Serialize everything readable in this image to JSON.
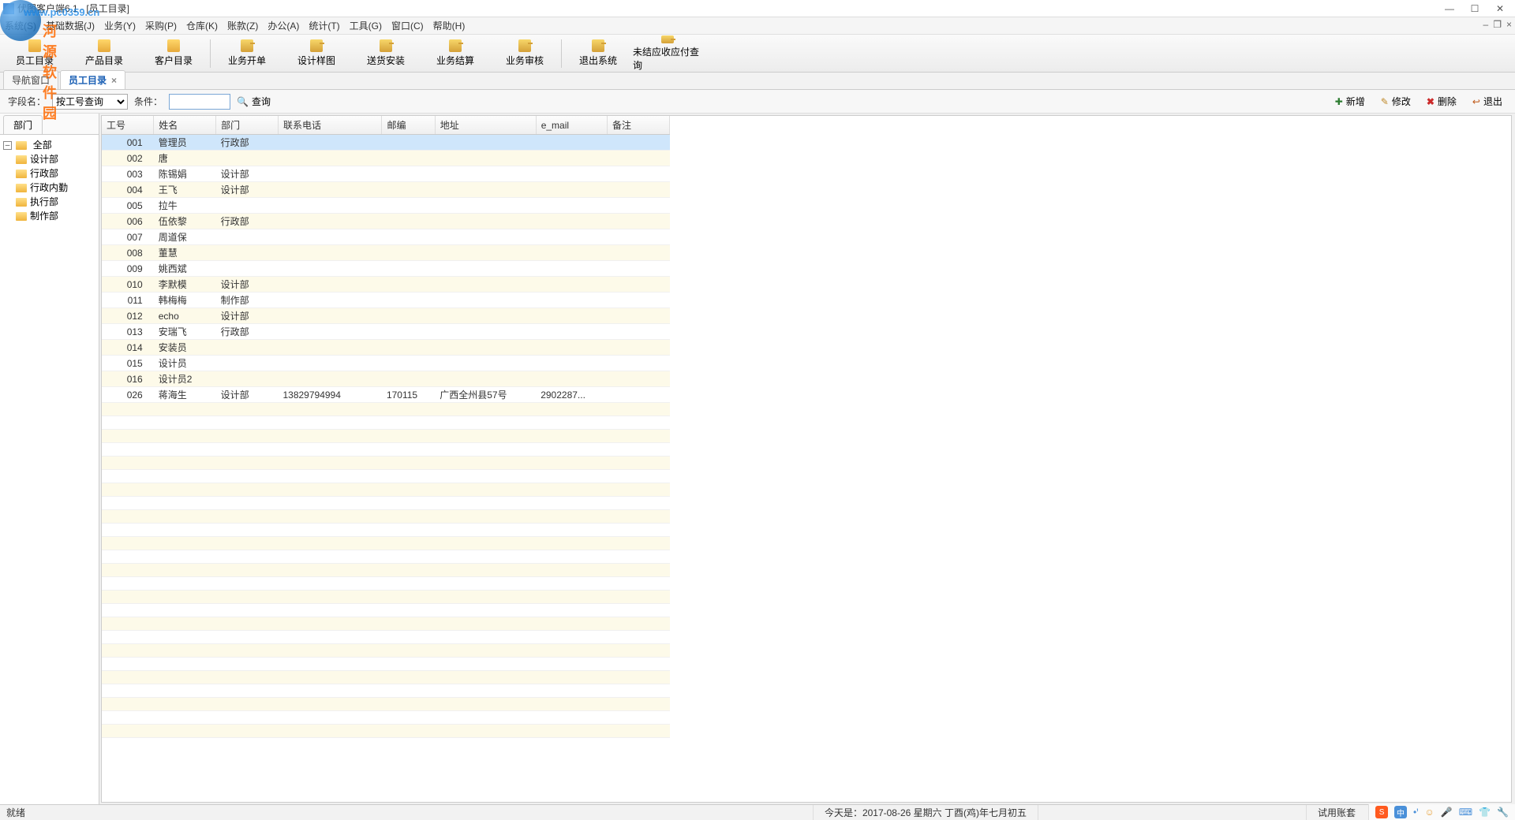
{
  "window": {
    "title": "伏图客户端6.1 - [员工目录]"
  },
  "watermark": {
    "line1": "www.pc0359.cn",
    "line2": "河源软件园"
  },
  "menubar": [
    "系统(S)",
    "基础数据(J)",
    "业务(Y)",
    "采购(P)",
    "仓库(K)",
    "账款(Z)",
    "办公(A)",
    "统计(T)",
    "工具(G)",
    "窗口(C)",
    "帮助(H)"
  ],
  "toolbar": [
    "员工目录",
    "产品目录",
    "客户目录",
    "业务开单",
    "设计样图",
    "送货安装",
    "业务结算",
    "业务审核",
    "退出系统",
    "未结应收应付查询"
  ],
  "tabs": [
    {
      "label": "导航窗口",
      "active": false,
      "closable": false
    },
    {
      "label": "员工目录",
      "active": true,
      "closable": true
    }
  ],
  "search": {
    "field_label": "字段名：",
    "field_value": "按工号查询",
    "cond_label": "条件：",
    "cond_value": "",
    "btn_query": "查询"
  },
  "actions": {
    "new_": "新增",
    "edit": "修改",
    "del": "删除",
    "exit": "退出"
  },
  "treetab": "部门",
  "tree": {
    "root": "全部",
    "children": [
      "设计部",
      "行政部",
      "行政内勤",
      "执行部",
      "制作部"
    ]
  },
  "grid": {
    "columns": [
      "工号",
      "姓名",
      "部门",
      "联系电话",
      "邮编",
      "地址",
      "e_mail",
      "备注"
    ],
    "rows": [
      {
        "id": "001",
        "name": "管理员",
        "dept": "行政部",
        "tel": "",
        "zip": "",
        "addr": "",
        "email": "",
        "memo": "",
        "sel": true
      },
      {
        "id": "002",
        "name": "唐",
        "dept": "",
        "tel": "",
        "zip": "",
        "addr": "",
        "email": "",
        "memo": ""
      },
      {
        "id": "003",
        "name": "陈锡娟",
        "dept": "设计部",
        "tel": "",
        "zip": "",
        "addr": "",
        "email": "",
        "memo": ""
      },
      {
        "id": "004",
        "name": "王飞",
        "dept": "设计部",
        "tel": "",
        "zip": "",
        "addr": "",
        "email": "",
        "memo": ""
      },
      {
        "id": "005",
        "name": "拉牛",
        "dept": "",
        "tel": "",
        "zip": "",
        "addr": "",
        "email": "",
        "memo": ""
      },
      {
        "id": "006",
        "name": "伍依黎",
        "dept": "行政部",
        "tel": "",
        "zip": "",
        "addr": "",
        "email": "",
        "memo": ""
      },
      {
        "id": "007",
        "name": "周道保",
        "dept": "",
        "tel": "",
        "zip": "",
        "addr": "",
        "email": "",
        "memo": ""
      },
      {
        "id": "008",
        "name": "董慧",
        "dept": "",
        "tel": "",
        "zip": "",
        "addr": "",
        "email": "",
        "memo": ""
      },
      {
        "id": "009",
        "name": "姚西斌",
        "dept": "",
        "tel": "",
        "zip": "",
        "addr": "",
        "email": "",
        "memo": ""
      },
      {
        "id": "010",
        "name": "李默模",
        "dept": "设计部",
        "tel": "",
        "zip": "",
        "addr": "",
        "email": "",
        "memo": ""
      },
      {
        "id": "011",
        "name": "韩梅梅",
        "dept": "制作部",
        "tel": "",
        "zip": "",
        "addr": "",
        "email": "",
        "memo": ""
      },
      {
        "id": "012",
        "name": "echo",
        "dept": "设计部",
        "tel": "",
        "zip": "",
        "addr": "",
        "email": "",
        "memo": ""
      },
      {
        "id": "013",
        "name": "安瑞飞",
        "dept": "行政部",
        "tel": "",
        "zip": "",
        "addr": "",
        "email": "",
        "memo": ""
      },
      {
        "id": "014",
        "name": "安装员",
        "dept": "",
        "tel": "",
        "zip": "",
        "addr": "",
        "email": "",
        "memo": ""
      },
      {
        "id": "015",
        "name": "设计员",
        "dept": "",
        "tel": "",
        "zip": "",
        "addr": "",
        "email": "",
        "memo": ""
      },
      {
        "id": "016",
        "name": "设计员2",
        "dept": "",
        "tel": "",
        "zip": "",
        "addr": "",
        "email": "",
        "memo": ""
      },
      {
        "id": "026",
        "name": "蒋海生",
        "dept": "设计部",
        "tel": "13829794994",
        "zip": "170115",
        "addr": "广西全州县57号",
        "email": "2902287...",
        "memo": ""
      }
    ]
  },
  "status": {
    "ready": "就绪",
    "date": "今天是：2017-08-26 星期六 丁酉(鸡)年七月初五",
    "acct": "试用账套"
  },
  "ime": {
    "zhong": "中"
  }
}
